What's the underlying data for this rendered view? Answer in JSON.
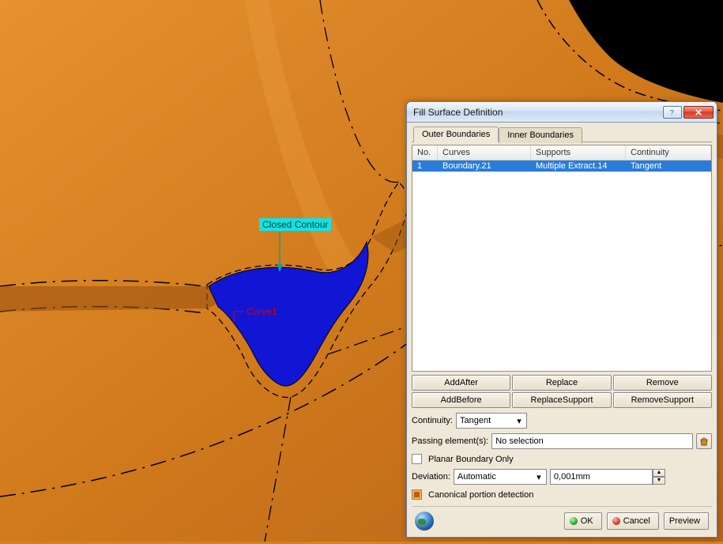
{
  "viewport": {
    "closed_contour_label": "Closed Contour",
    "curve1_label": "Curve1"
  },
  "dialog": {
    "title": "Fill Surface Definition",
    "tabs": {
      "outer": "Outer Boundaries",
      "inner": "Inner Boundaries"
    },
    "table": {
      "headers": {
        "no": "No.",
        "curves": "Curves",
        "supports": "Supports",
        "continuity": "Continuity"
      },
      "rows": [
        {
          "no": "1",
          "curves": "Boundary.21",
          "supports": "Multiple Extract.14",
          "continuity": "Tangent"
        }
      ]
    },
    "buttons": {
      "add_after": "AddAfter",
      "replace": "Replace",
      "remove": "Remove",
      "add_before": "AddBefore",
      "replace_support": "ReplaceSupport",
      "remove_support": "RemoveSupport"
    },
    "continuity_label": "Continuity:",
    "continuity_value": "Tangent",
    "passing_label": "Passing element(s):",
    "passing_value": "No selection",
    "planar_label": "Planar Boundary Only",
    "planar_checked": false,
    "deviation_label": "Deviation:",
    "deviation_mode": "Automatic",
    "deviation_value": "0,001mm",
    "canonical_label": "Canonical portion detection",
    "canonical_checked": true,
    "footer": {
      "ok": "OK",
      "cancel": "Cancel",
      "preview": "Preview"
    }
  }
}
